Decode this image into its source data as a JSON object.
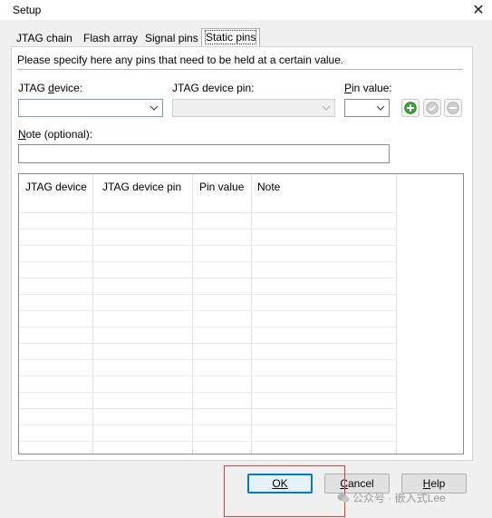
{
  "window": {
    "title": "Setup",
    "close_label": "✕"
  },
  "tabs": [
    {
      "label": "JTAG chain"
    },
    {
      "label": "Flash array"
    },
    {
      "label": "Signal pins"
    },
    {
      "label": "Static pins",
      "active": true
    }
  ],
  "panel": {
    "instruction": "Please specify here any pins that need to be held at a certain value.",
    "jtag_device": {
      "label_prefix": "JTAG ",
      "label_access": "d",
      "label_rest": "evice:",
      "value": ""
    },
    "jtag_device_pin": {
      "label": "JTAG device pin:",
      "value": ""
    },
    "pin_value": {
      "label_access": "P",
      "label_rest": "in value:",
      "value": ""
    },
    "note": {
      "label_access": "N",
      "label_rest": "ote (optional):",
      "value": ""
    },
    "add_icon": "plus-circle-icon",
    "apply_icon": "check-circle-icon",
    "remove_icon": "minus-circle-icon",
    "table": {
      "columns": [
        "JTAG device",
        "JTAG device pin",
        "Pin value",
        "Note"
      ],
      "rows": []
    }
  },
  "buttons": {
    "ok": {
      "label": "OK",
      "access": "O"
    },
    "cancel": {
      "access": "C",
      "rest": "ancel"
    },
    "help": {
      "access": "H",
      "rest": "elp"
    }
  },
  "watermark": {
    "text": "公众号 · 嵌入式Lee"
  },
  "colors": {
    "accent": "#0078d7",
    "highlight_box": "#e53935",
    "add_green": "#3ea53a"
  }
}
